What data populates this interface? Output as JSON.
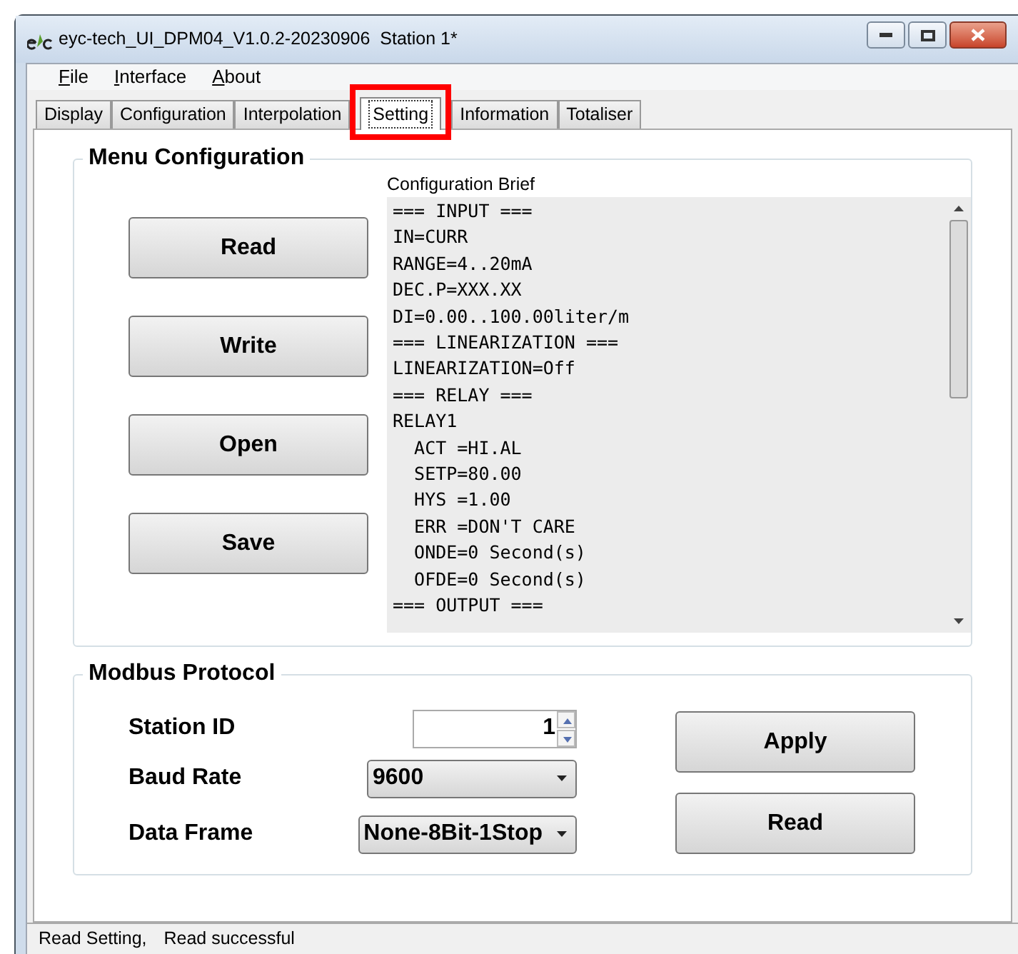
{
  "window": {
    "title": "eyc-tech_UI_DPM04_V1.0.2-20230906  Station 1*"
  },
  "menu": [
    {
      "label": "File"
    },
    {
      "label": "Interface"
    },
    {
      "label": "About"
    }
  ],
  "tabs": [
    {
      "label": "Display",
      "selected": false,
      "highlighted": false
    },
    {
      "label": "Configuration",
      "selected": false,
      "highlighted": false
    },
    {
      "label": "Interpolation",
      "selected": false,
      "highlighted": false
    },
    {
      "label": "Setting",
      "selected": true,
      "highlighted": true
    },
    {
      "label": "Information",
      "selected": false,
      "highlighted": false
    },
    {
      "label": "Totaliser",
      "selected": false,
      "highlighted": false
    }
  ],
  "menu_configuration": {
    "title": "Menu Configuration",
    "buttons": [
      "Read",
      "Write",
      "Open",
      "Save"
    ],
    "brief_label": "Configuration Brief",
    "brief_lines": [
      "=== INPUT ===",
      "IN=CURR",
      "RANGE=4..20mA",
      "DEC.P=XXX.XX",
      "DI=0.00..100.00liter/m",
      "=== LINEARIZATION ===",
      "LINEARIZATION=Off",
      "=== RELAY ===",
      "RELAY1",
      "  ACT =HI.AL",
      "  SETP=80.00",
      "  HYS =1.00",
      "  ERR =DON'T CARE",
      "  ONDE=0 Second(s)",
      "  OFDE=0 Second(s)",
      "=== OUTPUT ==="
    ]
  },
  "modbus": {
    "title": "Modbus Protocol",
    "fields": [
      {
        "label": "Station ID",
        "kind": "spin",
        "value": "1"
      },
      {
        "label": "Baud Rate",
        "kind": "dropdown",
        "value": "9600"
      },
      {
        "label": "Data Frame",
        "kind": "dropdown",
        "value": "None-8Bit-1Stop"
      }
    ],
    "buttons": [
      "Apply",
      "Read"
    ]
  },
  "status_bar": [
    "Read Setting,",
    "Read successful"
  ]
}
